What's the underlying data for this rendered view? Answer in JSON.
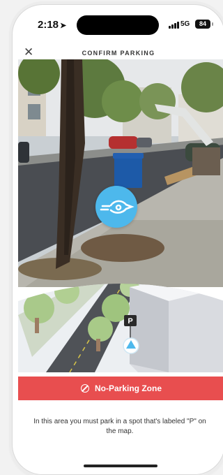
{
  "status_bar": {
    "time": "2:18",
    "network": "5G",
    "battery": "84"
  },
  "header": {
    "close_icon": "close-icon",
    "title": "CONFIRM PARKING"
  },
  "map": {
    "parking_marker_label": "P"
  },
  "banner": {
    "icon": "no-parking-icon",
    "text": "No-Parking Zone",
    "color": "#e84e4f"
  },
  "description": "In this area you must park in a spot that's labeled \"P\" on the map.",
  "colors": {
    "accent": "#4db8ec",
    "alert": "#e84e4f"
  }
}
